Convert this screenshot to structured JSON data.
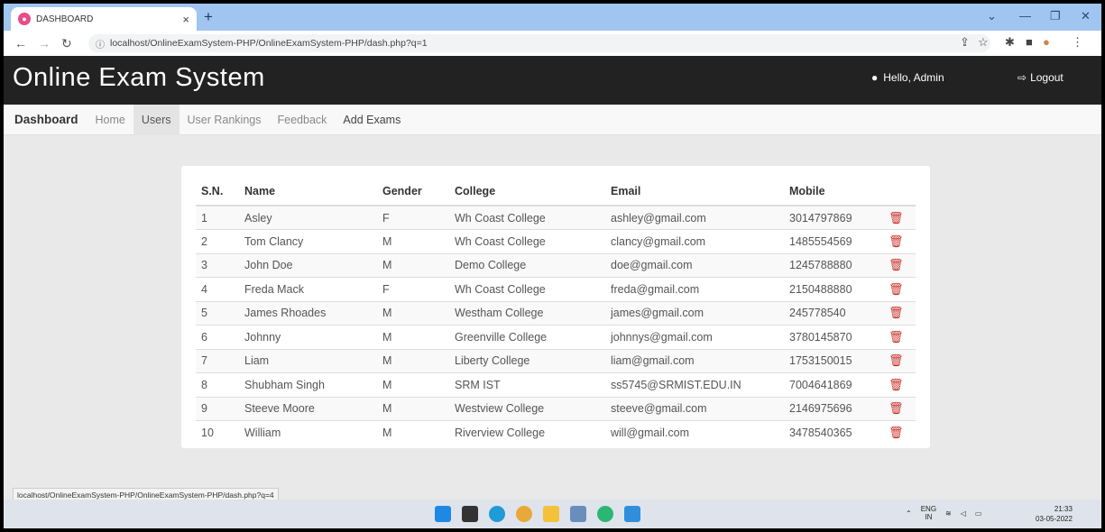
{
  "browser": {
    "tab_title": "DASHBOARD",
    "url": "localhost/OnlineExamSystem-PHP/OnlineExamSystem-PHP/dash.php?q=1",
    "status_url": "localhost/OnlineExamSystem-PHP/OnlineExamSystem-PHP/dash.php?q=4"
  },
  "header": {
    "title": "Online Exam System",
    "greeting": "Hello, Admin",
    "logout_label": "Logout"
  },
  "nav": {
    "brand": "Dashboard",
    "items": [
      "Home",
      "Users",
      "User Rankings",
      "Feedback",
      "Add Exams"
    ]
  },
  "table": {
    "headers": [
      "S.N.",
      "Name",
      "Gender",
      "College",
      "Email",
      "Mobile"
    ],
    "rows": [
      [
        "1",
        "Asley",
        "F",
        "Wh Coast College",
        "ashley@gmail.com",
        "3014797869"
      ],
      [
        "2",
        "Tom Clancy",
        "M",
        "Wh Coast College",
        "clancy@gmail.com",
        "1485554569"
      ],
      [
        "3",
        "John Doe",
        "M",
        "Demo College",
        "doe@gmail.com",
        "1245788880"
      ],
      [
        "4",
        "Freda Mack",
        "F",
        "Wh Coast College",
        "freda@gmail.com",
        "2150488880"
      ],
      [
        "5",
        "James Rhoades",
        "M",
        "Westham College",
        "james@gmail.com",
        "245778540"
      ],
      [
        "6",
        "Johnny",
        "M",
        "Greenville College",
        "johnnys@gmail.com",
        "3780145870"
      ],
      [
        "7",
        "Liam",
        "M",
        "Liberty College",
        "liam@gmail.com",
        "1753150015"
      ],
      [
        "8",
        "Shubham Singh",
        "M",
        "SRM IST",
        "ss5745@SRMIST.EDU.IN",
        "7004641869"
      ],
      [
        "9",
        "Steeve Moore",
        "M",
        "Westview College",
        "steeve@gmail.com",
        "2146975696"
      ],
      [
        "10",
        "William",
        "M",
        "Riverview College",
        "will@gmail.com",
        "3478540365"
      ]
    ]
  },
  "taskbar": {
    "lang": "ENG",
    "region": "IN",
    "time": "21:33",
    "date": "03-05-2022"
  },
  "colors": {
    "header_bg": "#222222",
    "delete_icon": "#c9302c",
    "tabstrip": "#9fc5f0"
  }
}
